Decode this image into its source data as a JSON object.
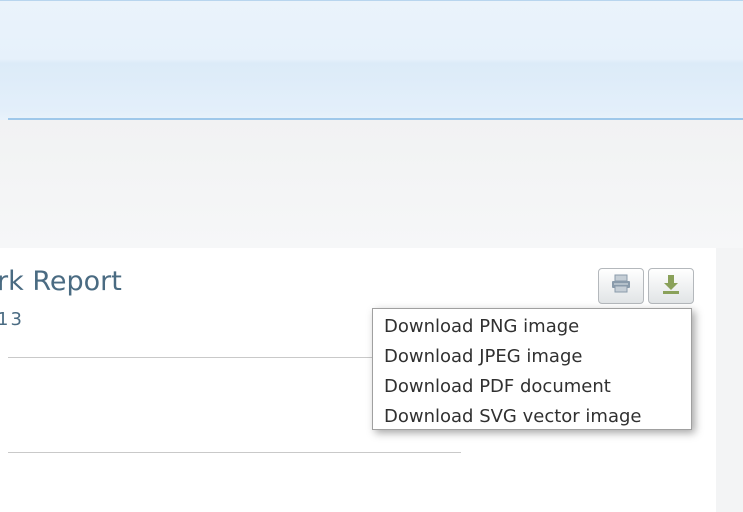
{
  "chart": {
    "title": "rk Report",
    "subtitle": "13"
  },
  "toolbar": {
    "print_icon": "printer-icon",
    "download_icon": "download-arrow-icon"
  },
  "export_menu": {
    "items": [
      {
        "label": "Download PNG image"
      },
      {
        "label": "Download JPEG image"
      },
      {
        "label": "Download PDF document"
      },
      {
        "label": "Download SVG vector image"
      }
    ]
  },
  "colors": {
    "title": "#4a6b82",
    "header_band": "#e6f1fb",
    "header_border": "#9fc8ea",
    "download_icon": "#8aa15a",
    "print_icon": "#8a9bab"
  }
}
